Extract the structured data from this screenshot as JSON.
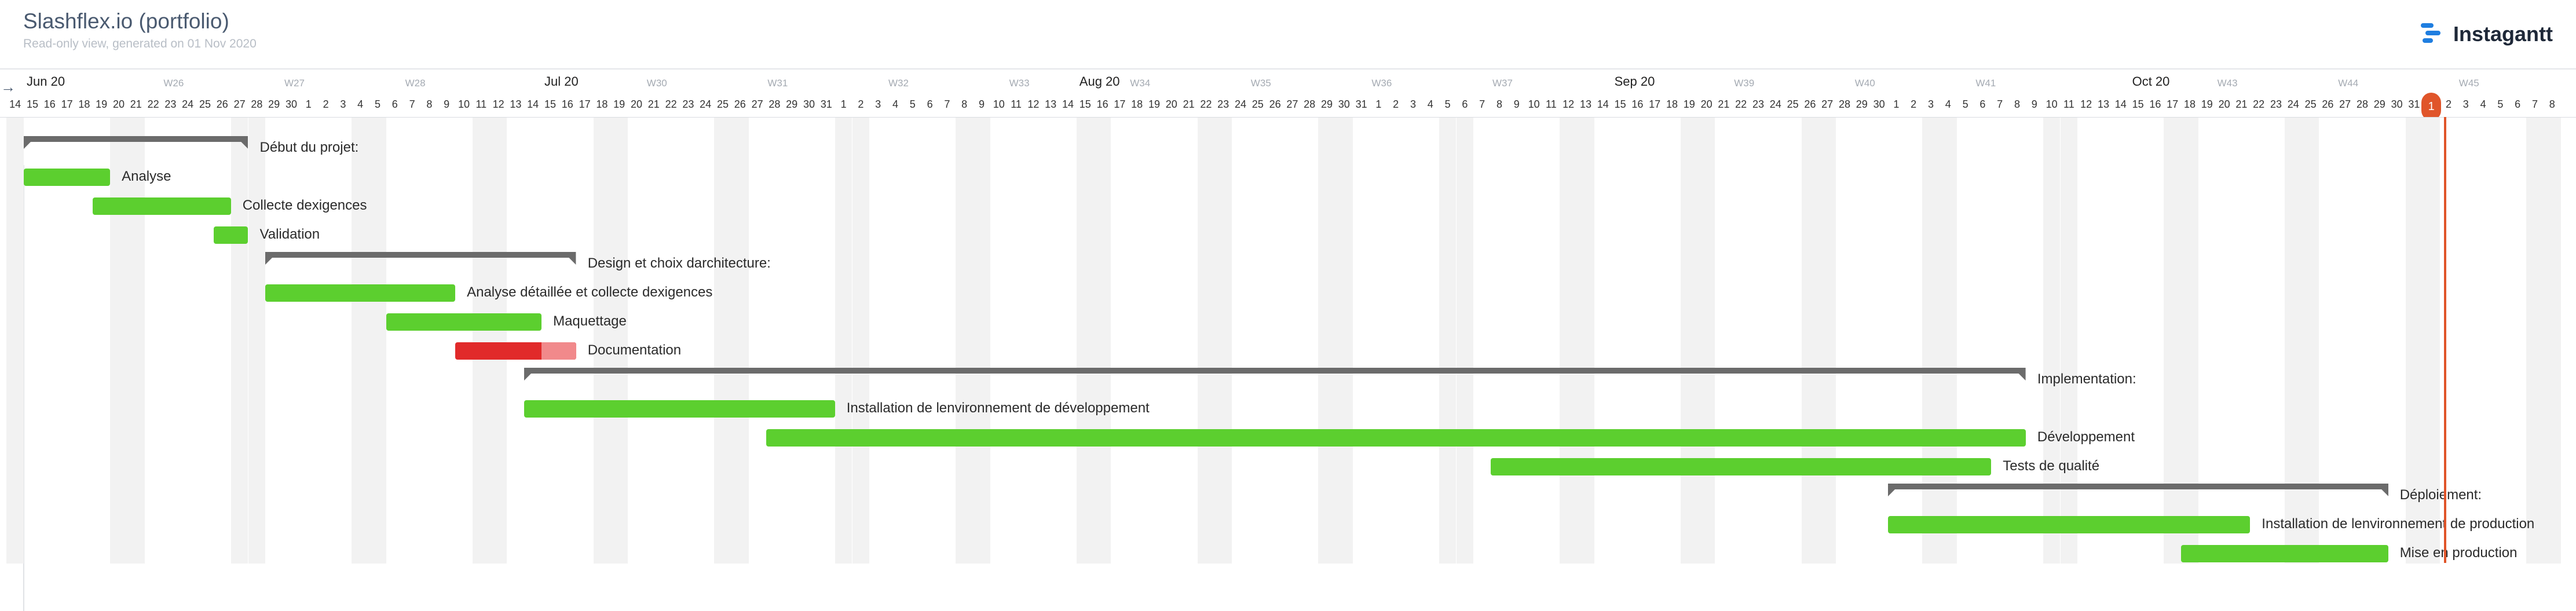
{
  "header": {
    "title": "Slashflex.io (portfolio)",
    "subtitle": "Read-only view, generated on 01 Nov 2020",
    "brand": "Instagantt",
    "brand_icon": "instagantt-logo-icon"
  },
  "nav": {
    "prev_icon": "arrow-left-icon",
    "prev_symbol": "→"
  },
  "timeline": {
    "start_date": "2020-06-14",
    "end_date": "2020-11-08",
    "today": "2020-11-01",
    "today_label": "1",
    "month_labels": [
      {
        "date": "2020-06-15",
        "label": "Jun 20"
      },
      {
        "date": "2020-07-15",
        "label": "Jul 20"
      },
      {
        "date": "2020-08-15",
        "label": "Aug 20"
      },
      {
        "date": "2020-09-15",
        "label": "Sep 20"
      },
      {
        "date": "2020-10-15",
        "label": "Oct 20"
      }
    ],
    "week_labels": [
      {
        "date": "2020-06-23",
        "label": "W26"
      },
      {
        "date": "2020-06-30",
        "label": "W27"
      },
      {
        "date": "2020-07-07",
        "label": "W28"
      },
      {
        "date": "2020-07-21",
        "label": "W30"
      },
      {
        "date": "2020-07-28",
        "label": "W31"
      },
      {
        "date": "2020-08-04",
        "label": "W32"
      },
      {
        "date": "2020-08-11",
        "label": "W33"
      },
      {
        "date": "2020-08-18",
        "label": "W34"
      },
      {
        "date": "2020-08-25",
        "label": "W35"
      },
      {
        "date": "2020-09-01",
        "label": "W36"
      },
      {
        "date": "2020-09-08",
        "label": "W37"
      },
      {
        "date": "2020-09-22",
        "label": "W39"
      },
      {
        "date": "2020-09-29",
        "label": "W40"
      },
      {
        "date": "2020-10-06",
        "label": "W41"
      },
      {
        "date": "2020-10-20",
        "label": "W43"
      },
      {
        "date": "2020-10-27",
        "label": "W44"
      },
      {
        "date": "2020-11-03",
        "label": "W45"
      }
    ],
    "colors": {
      "task": "#5ccf2f",
      "late_task": "#e12a2a",
      "late_overdue": "#f1898b",
      "group": "#6b6b6b",
      "today": "#e0552a",
      "weekend": "#f2f2f2"
    }
  },
  "tasks": [
    {
      "name": "Début du projet:",
      "type": "group",
      "start": "2020-06-15",
      "end": "2020-06-27"
    },
    {
      "name": "Analyse",
      "type": "task",
      "start": "2020-06-15",
      "end": "2020-06-19"
    },
    {
      "name": "Collecte dexigences",
      "type": "task",
      "start": "2020-06-19",
      "end": "2020-06-26"
    },
    {
      "name": "Validation",
      "type": "task",
      "start": "2020-06-26",
      "end": "2020-06-27"
    },
    {
      "name": "Design et choix darchitecture:",
      "type": "group",
      "start": "2020-06-29",
      "end": "2020-07-16"
    },
    {
      "name": "Analyse détaillée et collecte dexigences",
      "type": "task",
      "start": "2020-06-29",
      "end": "2020-07-09"
    },
    {
      "name": "Maquettage",
      "type": "task",
      "start": "2020-07-06",
      "end": "2020-07-14"
    },
    {
      "name": "Documentation",
      "type": "task",
      "status": "late",
      "start": "2020-07-10",
      "end": "2020-07-16",
      "overdue_from": "2020-07-15"
    },
    {
      "name": "Implementation:",
      "type": "group",
      "start": "2020-07-14",
      "end": "2020-10-08"
    },
    {
      "name": "Installation de lenvironnement de développement",
      "type": "task",
      "start": "2020-07-14",
      "end": "2020-07-31"
    },
    {
      "name": "Développement",
      "type": "task",
      "start": "2020-07-28",
      "end": "2020-10-08"
    },
    {
      "name": "Tests de qualité",
      "type": "task",
      "start": "2020-09-08",
      "end": "2020-10-06"
    },
    {
      "name": "Déploiement:",
      "type": "group",
      "start": "2020-10-01",
      "end": "2020-10-29"
    },
    {
      "name": "Installation de lenvironnement de production",
      "type": "task",
      "start": "2020-10-01",
      "end": "2020-10-21"
    },
    {
      "name": "Mise en production",
      "type": "task",
      "start": "2020-10-18",
      "end": "2020-10-29"
    }
  ]
}
